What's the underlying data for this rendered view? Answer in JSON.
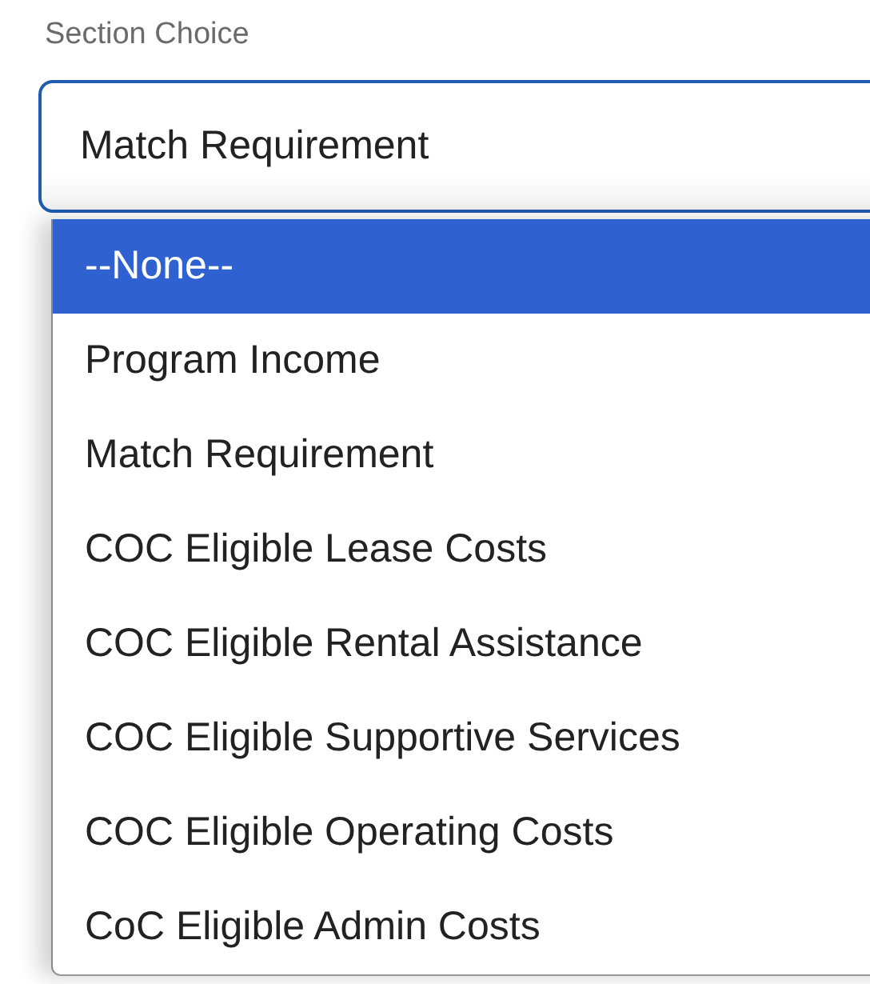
{
  "field": {
    "label": "Section Choice",
    "value": "Match Requirement"
  },
  "options": [
    {
      "label": "--None--",
      "selected": true
    },
    {
      "label": "Program Income",
      "selected": false
    },
    {
      "label": "Match Requirement",
      "selected": false
    },
    {
      "label": "COC Eligible Lease Costs",
      "selected": false
    },
    {
      "label": "COC Eligible Rental Assistance",
      "selected": false
    },
    {
      "label": "COC Eligible Supportive Services",
      "selected": false
    },
    {
      "label": "COC Eligible Operating Costs",
      "selected": false
    },
    {
      "label": "CoC Eligible Admin Costs",
      "selected": false
    }
  ]
}
